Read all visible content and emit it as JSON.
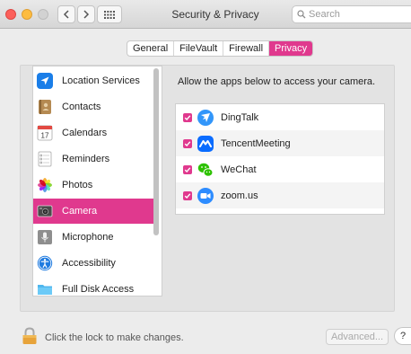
{
  "window": {
    "title": "Security & Privacy"
  },
  "search": {
    "placeholder": "Search"
  },
  "tabs": [
    {
      "label": "General"
    },
    {
      "label": "FileVault"
    },
    {
      "label": "Firewall"
    },
    {
      "label": "Privacy",
      "active": true
    }
  ],
  "sidebar": {
    "items": [
      {
        "label": "Location Services",
        "icon": "location-arrow-icon"
      },
      {
        "label": "Contacts",
        "icon": "contacts-book-icon"
      },
      {
        "label": "Calendars",
        "icon": "calendar-icon",
        "icon_text": "17"
      },
      {
        "label": "Reminders",
        "icon": "reminders-list-icon"
      },
      {
        "label": "Photos",
        "icon": "photos-flower-icon"
      },
      {
        "label": "Camera",
        "icon": "camera-icon",
        "selected": true
      },
      {
        "label": "Microphone",
        "icon": "microphone-icon"
      },
      {
        "label": "Accessibility",
        "icon": "accessibility-icon"
      },
      {
        "label": "Full Disk Access",
        "icon": "folder-icon"
      }
    ]
  },
  "main": {
    "prompt": "Allow the apps below to access your camera.",
    "apps": [
      {
        "label": "DingTalk",
        "checked": true,
        "icon": "dingtalk-icon"
      },
      {
        "label": "TencentMeeting",
        "checked": true,
        "icon": "tencentmeeting-icon"
      },
      {
        "label": "WeChat",
        "checked": true,
        "icon": "wechat-icon"
      },
      {
        "label": "zoom.us",
        "checked": true,
        "icon": "zoom-icon"
      }
    ]
  },
  "footer": {
    "lock_text": "Click the lock to make changes.",
    "advanced_label": "Advanced...",
    "help_label": "?"
  },
  "colors": {
    "accent": "#e0398e",
    "zoom": "#2d8cff",
    "dingtalk": "#3296fa",
    "wechat": "#2dc100",
    "tencent": "#0a6cff"
  }
}
